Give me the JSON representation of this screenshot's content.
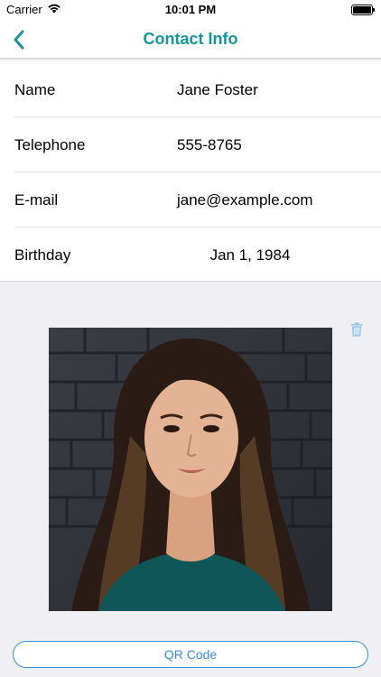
{
  "status_bar": {
    "carrier": "Carrier",
    "time": "10:01 PM",
    "battery_level": 1.0,
    "icons": [
      "wifi-icon",
      "battery-icon"
    ]
  },
  "nav": {
    "title": "Contact Info",
    "back_icon": "chevron-left-icon",
    "accent_color": "#13979a"
  },
  "contact": {
    "rows": [
      {
        "label": "Name",
        "value": "Jane Foster"
      },
      {
        "label": "Telephone",
        "value": "555-8765"
      },
      {
        "label": "E-mail",
        "value": "jane@example.com"
      },
      {
        "label": "Birthday",
        "value": "Jan 1, 1984"
      }
    ]
  },
  "photo": {
    "delete_icon": "trash-icon",
    "delete_icon_color": "#9ec6f0"
  },
  "actions": {
    "qr_label": "QR Code",
    "qr_color": "#3b8fd9"
  }
}
